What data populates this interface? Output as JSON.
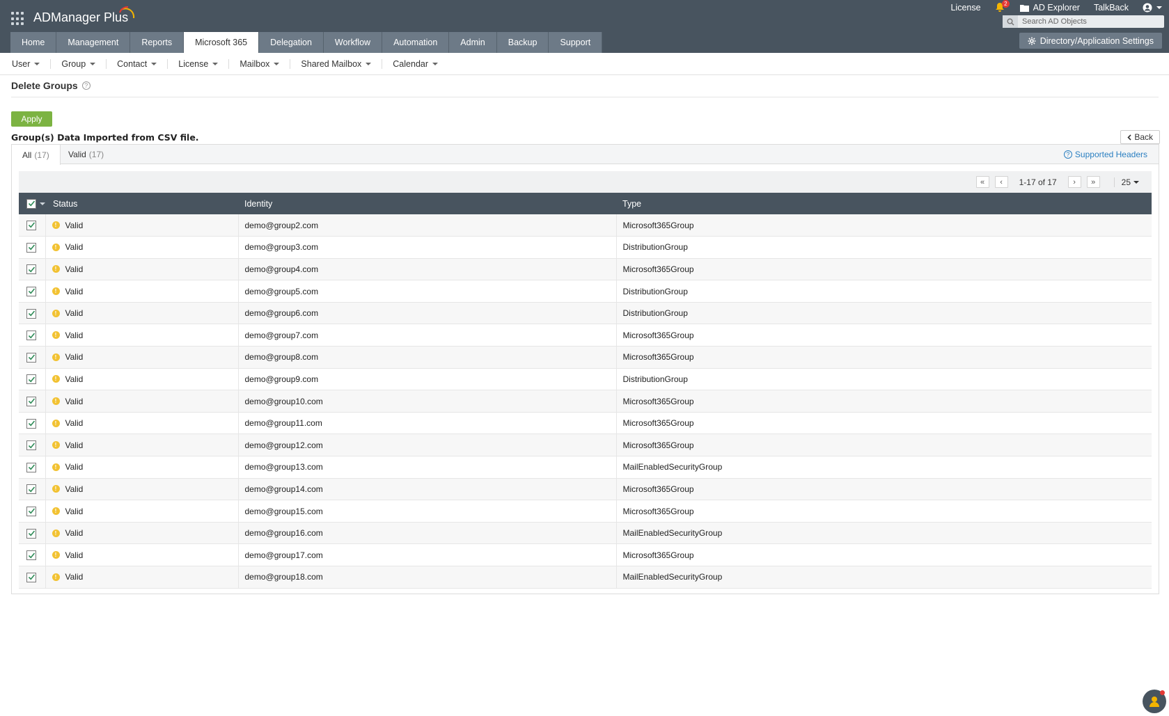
{
  "app": {
    "logo_text": "ADManager Plus"
  },
  "top_links": {
    "license": "License",
    "notification_count": "2",
    "ad_explorer": "AD Explorer",
    "talkback": "TalkBack"
  },
  "search": {
    "placeholder": "Search AD Objects"
  },
  "nav_tabs": [
    "Home",
    "Management",
    "Reports",
    "Microsoft 365",
    "Delegation",
    "Workflow",
    "Automation",
    "Admin",
    "Backup",
    "Support"
  ],
  "active_tab": "Microsoft 365",
  "settings_label": "Directory/Application Settings",
  "subnav": [
    "User",
    "Group",
    "Contact",
    "License",
    "Mailbox",
    "Shared Mailbox",
    "Calendar"
  ],
  "page_title": "Delete Groups",
  "apply_label": "Apply",
  "import_label": "Group(s) Data Imported from CSV file.",
  "back_label": "Back",
  "tabs": [
    {
      "label": "All",
      "count": "(17)"
    },
    {
      "label": "Valid",
      "count": "(17)"
    }
  ],
  "supported_headers": "Supported Headers",
  "pager": {
    "info": "1-17 of 17",
    "page_size": "25"
  },
  "columns": {
    "status": "Status",
    "identity": "Identity",
    "type": "Type"
  },
  "rows": [
    {
      "status": "Valid",
      "identity": "demo@group2.com",
      "type": "Microsoft365Group"
    },
    {
      "status": "Valid",
      "identity": "demo@group3.com",
      "type": "DistributionGroup"
    },
    {
      "status": "Valid",
      "identity": "demo@group4.com",
      "type": "Microsoft365Group"
    },
    {
      "status": "Valid",
      "identity": "demo@group5.com",
      "type": "DistributionGroup"
    },
    {
      "status": "Valid",
      "identity": "demo@group6.com",
      "type": "DistributionGroup"
    },
    {
      "status": "Valid",
      "identity": "demo@group7.com",
      "type": "Microsoft365Group"
    },
    {
      "status": "Valid",
      "identity": "demo@group8.com",
      "type": "Microsoft365Group"
    },
    {
      "status": "Valid",
      "identity": "demo@group9.com",
      "type": "DistributionGroup"
    },
    {
      "status": "Valid",
      "identity": "demo@group10.com",
      "type": "Microsoft365Group"
    },
    {
      "status": "Valid",
      "identity": "demo@group11.com",
      "type": "Microsoft365Group"
    },
    {
      "status": "Valid",
      "identity": "demo@group12.com",
      "type": "Microsoft365Group"
    },
    {
      "status": "Valid",
      "identity": "demo@group13.com",
      "type": "MailEnabledSecurityGroup"
    },
    {
      "status": "Valid",
      "identity": "demo@group14.com",
      "type": "Microsoft365Group"
    },
    {
      "status": "Valid",
      "identity": "demo@group15.com",
      "type": "Microsoft365Group"
    },
    {
      "status": "Valid",
      "identity": "demo@group16.com",
      "type": "MailEnabledSecurityGroup"
    },
    {
      "status": "Valid",
      "identity": "demo@group17.com",
      "type": "Microsoft365Group"
    },
    {
      "status": "Valid",
      "identity": "demo@group18.com",
      "type": "MailEnabledSecurityGroup"
    }
  ],
  "colors": {
    "header_bg": "#48545f",
    "tab_bg": "#6d7a87",
    "apply_green": "#7cb342",
    "link_blue": "#2a7fc1",
    "warning_yellow": "#f2c232"
  }
}
